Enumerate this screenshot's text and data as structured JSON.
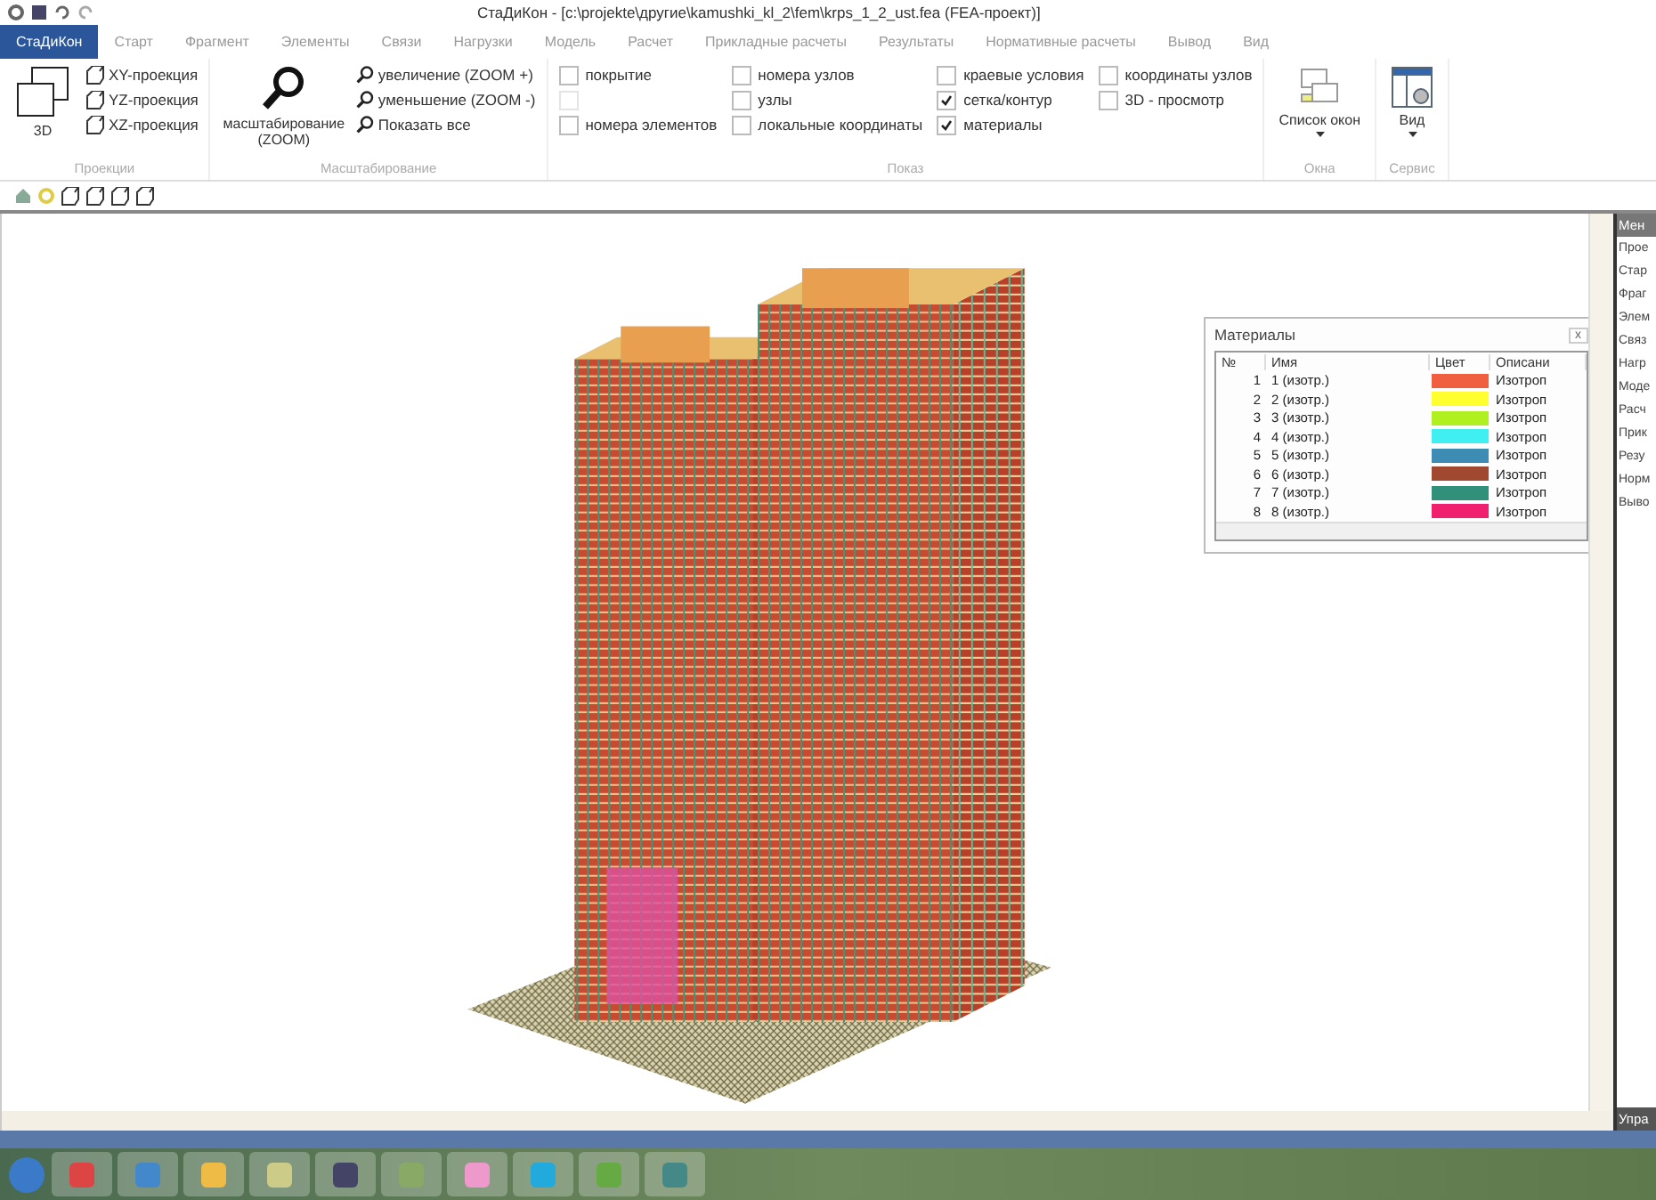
{
  "window": {
    "title": "СтаДиКон - [c:\\projekte\\другие\\kamushki_kl_2\\fem\\krps_1_2_ust.fea (FEA-проект)]"
  },
  "tabs": [
    {
      "label": "СтаДиКон",
      "selected": true
    },
    {
      "label": "Старт",
      "selected": false
    },
    {
      "label": "Фрагмент",
      "selected": false
    },
    {
      "label": "Элементы",
      "selected": false
    },
    {
      "label": "Связи",
      "selected": false
    },
    {
      "label": "Нагрузки",
      "selected": false
    },
    {
      "label": "Модель",
      "selected": false
    },
    {
      "label": "Расчет",
      "selected": false
    },
    {
      "label": "Прикладные расчеты",
      "selected": false
    },
    {
      "label": "Результаты",
      "selected": false
    },
    {
      "label": "Нормативные расчеты",
      "selected": false
    },
    {
      "label": "Вывод",
      "selected": false
    },
    {
      "label": "Вид",
      "selected": false
    }
  ],
  "ribbon": {
    "groups": [
      {
        "label": "Проекции",
        "items": [
          {
            "kind": "big",
            "label": "3D"
          },
          {
            "kind": "small",
            "label": "XY-проекция"
          },
          {
            "kind": "small",
            "label": "YZ-проекция"
          },
          {
            "kind": "small",
            "label": "XZ-проекция"
          }
        ]
      },
      {
        "label": "Масштабирование",
        "items": [
          {
            "kind": "big",
            "label": "масштабирование (ZOOM)"
          },
          {
            "kind": "small",
            "label": "увеличение (ZOOM +)"
          },
          {
            "kind": "small",
            "label": "уменьшение (ZOOM -)"
          },
          {
            "kind": "small",
            "label": "Показать все"
          }
        ]
      },
      {
        "label": "Показ",
        "items": [
          {
            "kind": "check",
            "label": "покрытие",
            "checked": false,
            "disabled": false
          },
          {
            "kind": "check",
            "checked": false,
            "disabled": true
          },
          {
            "kind": "check",
            "label": "номера элементов",
            "checked": false,
            "disabled": false
          },
          {
            "kind": "check",
            "label": "номера узлов",
            "checked": false,
            "disabled": false
          },
          {
            "kind": "check",
            "label": "узлы",
            "checked": false,
            "disabled": false
          },
          {
            "kind": "check",
            "label": "локальные координаты",
            "checked": false,
            "disabled": false
          },
          {
            "kind": "check",
            "label": "краевые условия",
            "checked": false,
            "disabled": false
          },
          {
            "kind": "check",
            "label": "сетка/контур",
            "checked": true,
            "disabled": false
          },
          {
            "kind": "check",
            "label": "материалы",
            "checked": true,
            "disabled": false
          },
          {
            "kind": "check",
            "label": "координаты узлов",
            "checked": false,
            "disabled": false
          },
          {
            "kind": "check",
            "label": "3D - просмотр",
            "checked": false,
            "disabled": false
          }
        ]
      },
      {
        "label": "Окна",
        "items": [
          {
            "kind": "big",
            "label": "Список окон",
            "dropdown": true
          }
        ]
      },
      {
        "label": "Сервис",
        "items": [
          {
            "kind": "big",
            "label": "Вид",
            "dropdown": true
          }
        ]
      }
    ]
  },
  "materials": {
    "title": "Материалы",
    "close": "x",
    "columns": [
      "№",
      "Имя",
      "Цвет",
      "Описани"
    ],
    "rows": [
      {
        "no": "1",
        "name": "1 (изотр.)",
        "color": "#f06040",
        "description": "Изотроп"
      },
      {
        "no": "2",
        "name": "2 (изотр.)",
        "color": "#ffff30",
        "description": "Изотроп"
      },
      {
        "no": "3",
        "name": "3 (изотр.)",
        "color": "#b0f020",
        "description": "Изотроп"
      },
      {
        "no": "4",
        "name": "4 (изотр.)",
        "color": "#40f0f0",
        "description": "Изотроп"
      },
      {
        "no": "5",
        "name": "5 (изотр.)",
        "color": "#3c8cb4",
        "description": "Изотроп"
      },
      {
        "no": "6",
        "name": "6 (изотр.)",
        "color": "#a04830",
        "description": "Изотроп"
      },
      {
        "no": "7",
        "name": "7 (изотр.)",
        "color": "#30907a",
        "description": "Изотроп"
      },
      {
        "no": "8",
        "name": "8 (изотр.)",
        "color": "#f0206e",
        "description": "Изотроп"
      }
    ]
  },
  "side_panel": {
    "header": "Мен",
    "items": [
      "Прое",
      "Стар",
      "Фраг",
      "Элем",
      "Связ",
      "Нагр",
      "Моде",
      "Расч",
      "Прик",
      "Резу",
      "Норм",
      "Выво"
    ],
    "footer": "Упра"
  }
}
